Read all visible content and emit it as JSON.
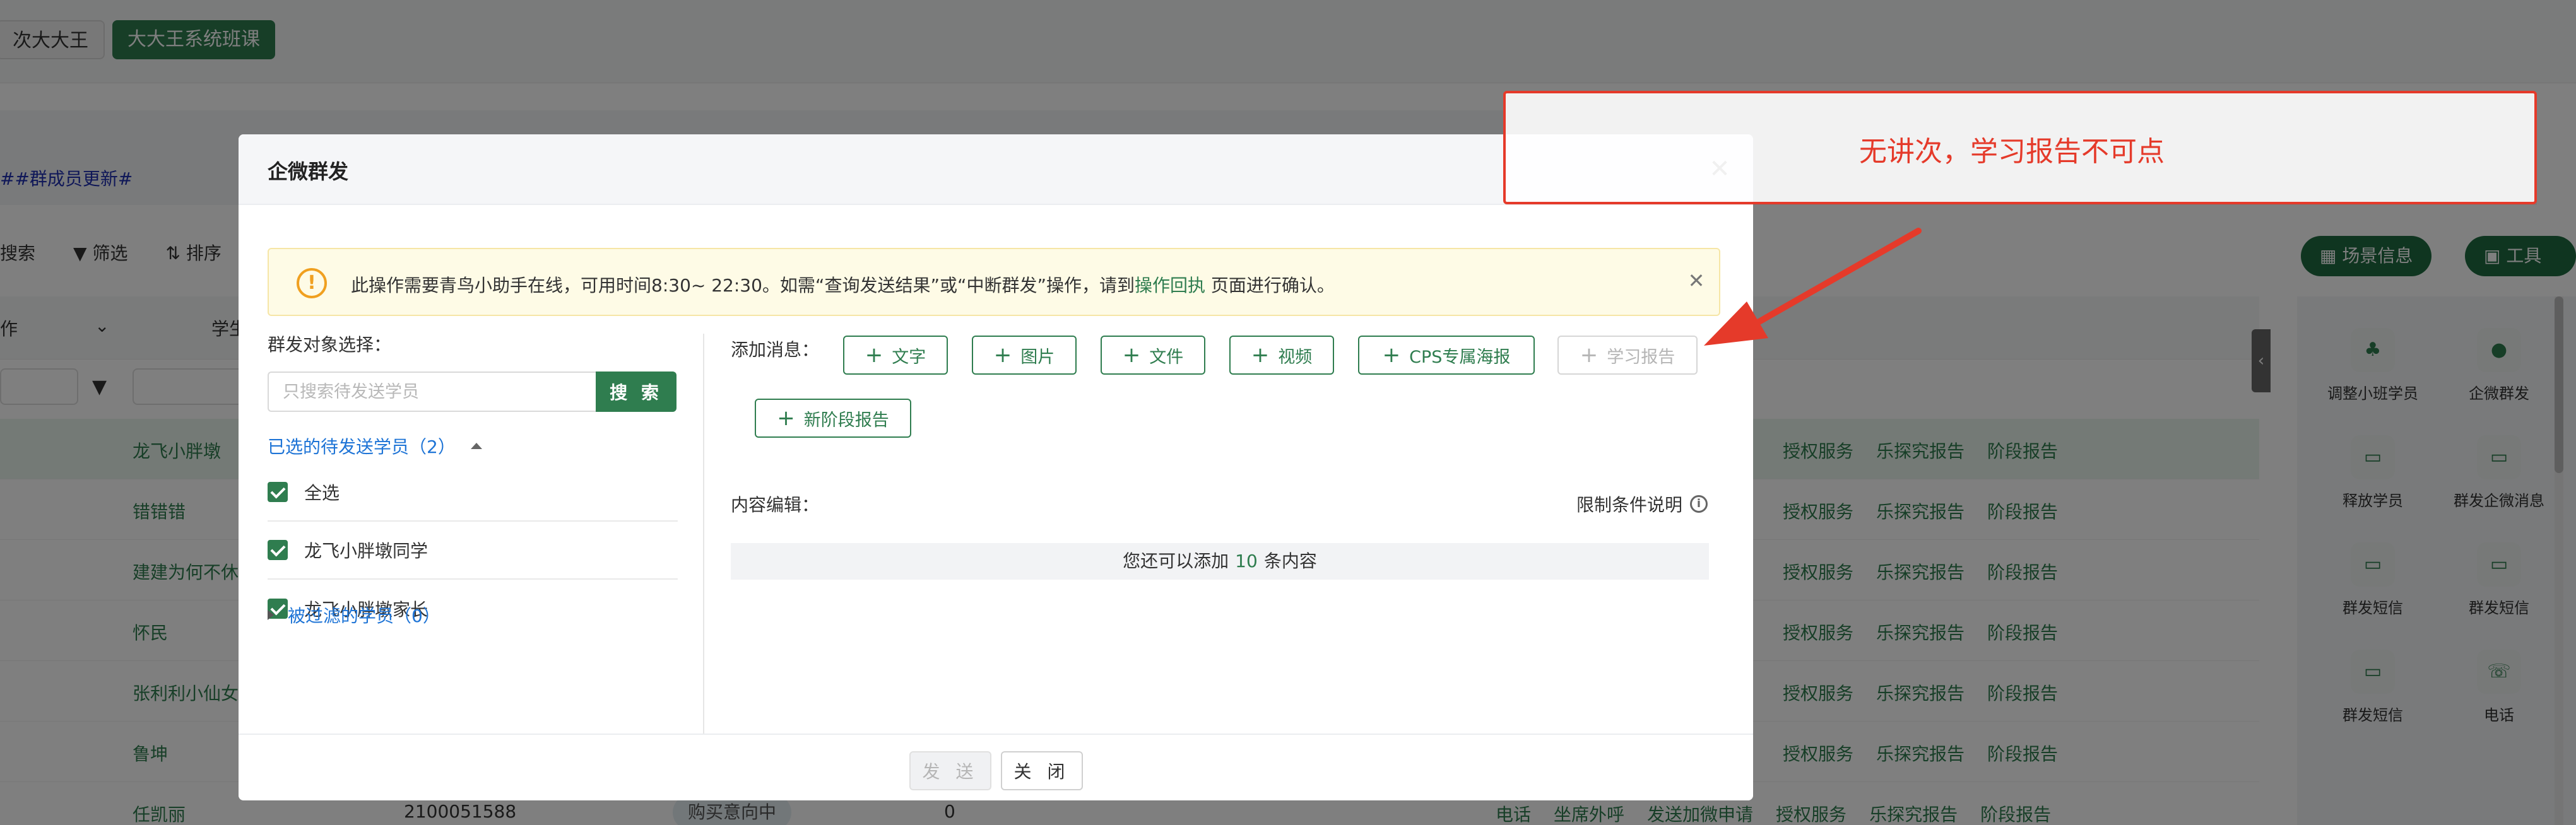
{
  "background": {
    "chips": [
      "次大大王",
      "大大王系统班课"
    ],
    "hashtag": "##群成员更新#",
    "toolbar": [
      "搜索",
      "筛选",
      "排序"
    ],
    "header_cells": [
      "作",
      "学生"
    ],
    "right_pills": [
      "场景信息",
      "工具箱"
    ],
    "rows": [
      {
        "name": "龙飞小胖墩",
        "links": [
          "授权服务",
          "乐探究报告",
          "阶段报告"
        ]
      },
      {
        "name": "错错错",
        "links": [
          "授权服务",
          "乐探究报告",
          "阶段报告"
        ]
      },
      {
        "name": "建建为何不休",
        "links": [
          "授权服务",
          "乐探究报告",
          "阶段报告"
        ]
      },
      {
        "name": "怀民",
        "links": [
          "授权服务",
          "乐探究报告",
          "阶段报告"
        ]
      },
      {
        "name": "张利利小仙女",
        "links": [
          "授权服务",
          "乐探究报告",
          "阶段报告"
        ]
      },
      {
        "name": "鲁坤",
        "links": [
          "授权服务",
          "乐探究报告",
          "阶段报告"
        ]
      },
      {
        "name": "任凯丽",
        "id": "2100051588",
        "tag": "购买意向中",
        "count": "0",
        "links": [
          "电话",
          "坐席外呼",
          "发送加微申请",
          "授权服务",
          "乐探究报告",
          "阶段报告"
        ]
      }
    ],
    "side_tools": [
      {
        "label": "调整小班学员",
        "icon": "users-icon"
      },
      {
        "label": "企微群发",
        "icon": "chat-icon"
      },
      {
        "label": "释放学员",
        "icon": "card-icon"
      },
      {
        "label": "群发企微消息",
        "icon": "card-icon"
      },
      {
        "label": "群发短信",
        "icon": "sms-icon"
      },
      {
        "label": "群发短信",
        "icon": "sms-icon"
      },
      {
        "label": "群发短信",
        "icon": "sms-icon"
      },
      {
        "label": "电话",
        "icon": "phone-icon"
      }
    ]
  },
  "modal": {
    "title": "企微群发",
    "notice": {
      "text_before": "此操作需要青鸟小助手在线，可用时间8:30~ 22:30。如需“查询发送结果”或“中断群发”操作，请到",
      "link": "操作回执",
      "text_after": "页面进行确认。"
    },
    "target_label": "群发对象选择：",
    "search": {
      "placeholder": "只搜索待发送学员",
      "value": "",
      "button": "搜 索"
    },
    "selected_title": "已选的待发送学员（2）",
    "select_all": "全选",
    "selected_items": [
      "龙飞小胖墩同学",
      "龙飞小胖墩家长"
    ],
    "filtered_title": "被过滤的学员（0）",
    "add_label": "添加消息：",
    "buttons": [
      {
        "label": "文字",
        "disabled": false
      },
      {
        "label": "图片",
        "disabled": false
      },
      {
        "label": "文件",
        "disabled": false
      },
      {
        "label": "视频",
        "disabled": false
      },
      {
        "label": "CPS专属海报",
        "disabled": false
      },
      {
        "label": "学习报告",
        "disabled": true
      },
      {
        "label": "新阶段报告",
        "disabled": false
      }
    ],
    "content_label": "内容编辑：",
    "limit_label": "限制条件说明",
    "content_hint_before": "您还可以添加",
    "content_hint_num": "10",
    "content_hint_after": "条内容",
    "send": "发 送",
    "close": "关 闭"
  },
  "annotation": {
    "text": "无讲次，学习报告不可点",
    "color": "#e53a2a"
  },
  "colors": {
    "accent": "#2f7d4f",
    "link": "#1e74d6",
    "warning": "#f0a020"
  }
}
